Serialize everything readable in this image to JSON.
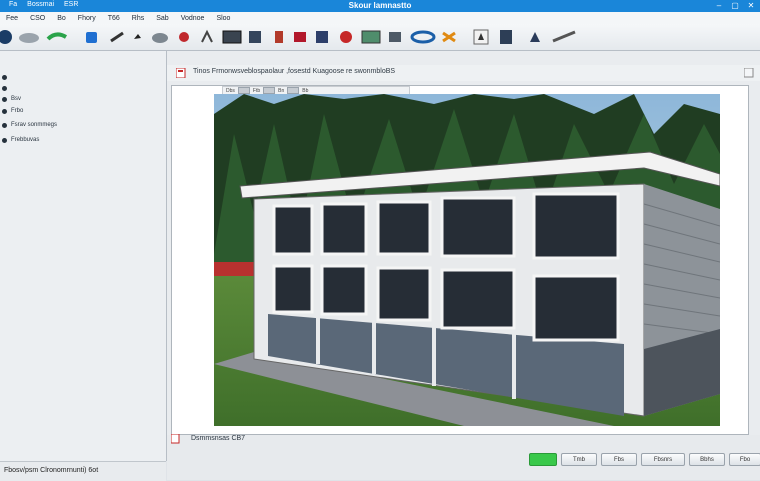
{
  "window": {
    "title": "Skour lamnastto",
    "menus": [
      "Fa",
      "Bossmai",
      "ESR"
    ],
    "controls": [
      "–",
      "▢",
      "✕"
    ]
  },
  "menubar": {
    "items": [
      "Fee",
      "CSO",
      "Bo",
      "Fhory",
      "T66",
      "Rhs",
      "Sab",
      "Vodnoe",
      "Sloo"
    ]
  },
  "toolbar": {
    "icons": [
      "globe-icon",
      "cloud-icon",
      "brush-icon",
      "bucket-icon",
      "pen-icon",
      "hook-icon",
      "hammer-icon",
      "record-icon",
      "cut-icon",
      "frame-icon",
      "book-icon",
      "marker-icon",
      "flag-icon",
      "shape-icon",
      "picture-icon",
      "lock-icon",
      "bridge-icon",
      "tools-icon",
      "pin-icon",
      "phone-icon",
      "ticket-icon",
      "link-icon"
    ]
  },
  "sidebar": {
    "items": [
      "",
      "",
      "Bsv",
      "Frbo",
      "Fsrav sonmmegs",
      "Frebbuvas"
    ]
  },
  "status": {
    "text": "Fbosv/psm Clronomrnunti) 6ot"
  },
  "document": {
    "path": "Tinos Frmonwsveblospaolaur ,fosestd Kuagoose  re swonmbloBS",
    "viewer_labels": [
      "Dbs",
      "Ftb",
      "Bn",
      "Bb"
    ],
    "bottom_label": "Dsmmsnsas CB7",
    "buttons": [
      "",
      "Tmb",
      "Fbs",
      "Fbsnrs",
      "Bbhs",
      "Fbo"
    ]
  },
  "colors": {
    "titlebar": "#1a86d9",
    "accent_green": "#39c84a"
  }
}
